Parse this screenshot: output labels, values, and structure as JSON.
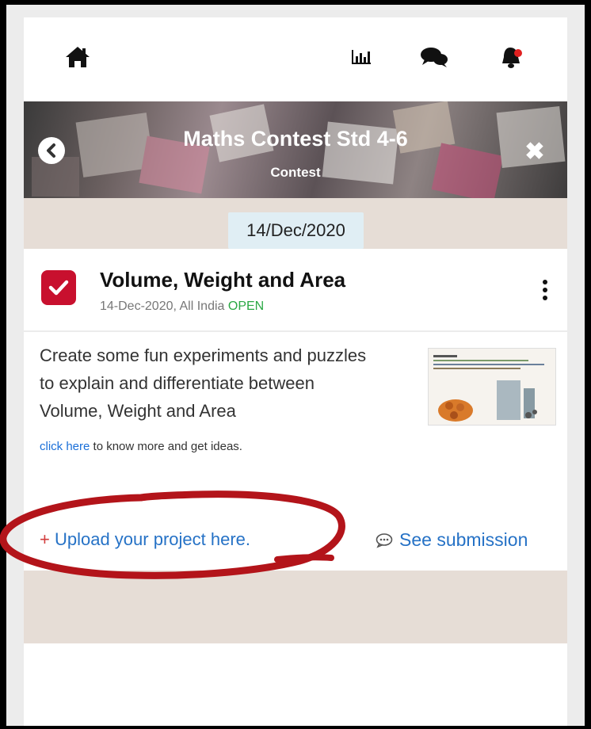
{
  "header": {
    "home_icon": "home-icon",
    "stats_icon": "bar-chart-icon",
    "chat_icon": "chat-bubbles-icon",
    "bell_icon": "bell-icon",
    "notification_color": "#e02020"
  },
  "banner": {
    "title": "Maths Contest Std 4-6",
    "subtitle": "Contest",
    "back_icon": "chevron-left-icon",
    "close_icon": "close-icon",
    "close_glyph": "✖"
  },
  "date_pill": "14/Dec/2020",
  "card": {
    "checkbox_icon": "check-icon",
    "title": "Volume, Weight and Area",
    "meta_prefix": "14-Dec-2020, All India ",
    "status": "OPEN",
    "status_color": "#2aa844",
    "menu_icon": "kebab-menu-icon",
    "description": "Create some fun experiments and puzzles to explain and differentiate between Volume, Weight and Area",
    "link_text": "click here",
    "link_suffix": " to know more and get ideas.",
    "upload_plus": "+",
    "upload_text": " Upload your project here.",
    "see_submission_icon": "comment-icon",
    "see_submission": "See submission"
  },
  "colors": {
    "accent_red": "#c8102e",
    "link_blue": "#2672c6",
    "band_beige": "#e6ddd6",
    "annotation_red": "#b3141a"
  }
}
